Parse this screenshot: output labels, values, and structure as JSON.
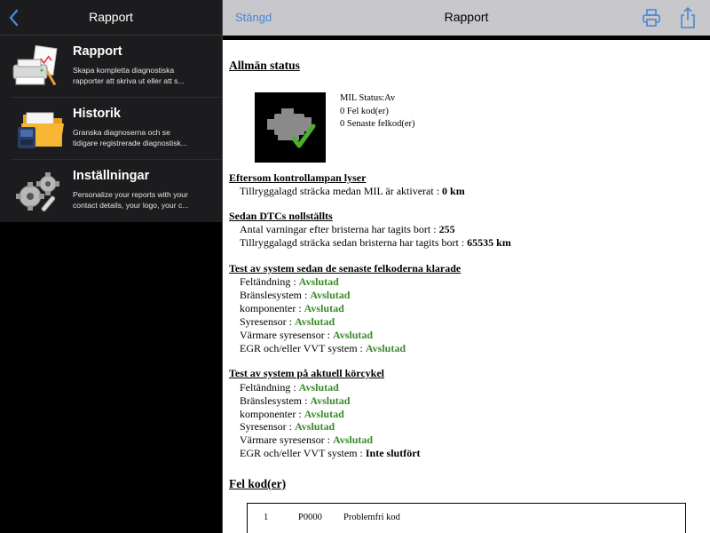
{
  "left": {
    "title": "Rapport",
    "menu": [
      {
        "title": "Rapport",
        "desc_line1": "Skapa kompletta diagnostiska",
        "desc_line2": "rapporter att skriva ut eller att s...",
        "icon": "report-printer-icon"
      },
      {
        "title": "Historik",
        "desc_line1": "Granska diagnoserna och se",
        "desc_line2": "tidigare registrerade diagnostisk...",
        "icon": "history-folder-icon"
      },
      {
        "title": "Inställningar",
        "desc_line1": "Personalize your reports with your",
        "desc_line2": "contact details, your logo, your c...",
        "icon": "settings-gears-icon"
      }
    ]
  },
  "right": {
    "close_label": "Stängd",
    "title": "Rapport"
  },
  "report": {
    "general_status": {
      "heading": "Allmän status",
      "mil_status": "MIL Status:Av",
      "fault_codes": "0 Fel kod(er)",
      "recent_fault_codes": "0 Senaste felkod(er)"
    },
    "mil_on": {
      "heading": "Eftersom kontrollampan lyser",
      "distance_label": "Tillryggalagd sträcka medan MIL är aktiverat : ",
      "distance_value": "0 km"
    },
    "dtcs_cleared": {
      "heading": "Sedan DTCs nollställts",
      "warmups_label": "Antal varningar efter bristerna har tagits bort : ",
      "warmups_value": "255",
      "distance_label": "Tillryggalagd sträcka sedan bristerna har tagits bort : ",
      "distance_value": "65535 km"
    },
    "since_clear_tests": {
      "heading": "Test av system sedan de senaste felkoderna klarade",
      "items": [
        {
          "label": "Feltändning : ",
          "value": "Avslutad"
        },
        {
          "label": "Bränslesystem : ",
          "value": "Avslutad"
        },
        {
          "label": "komponenter : ",
          "value": "Avslutad"
        },
        {
          "label": "Syresensor : ",
          "value": "Avslutad"
        },
        {
          "label": "Värmare syresensor : ",
          "value": "Avslutad"
        },
        {
          "label": "EGR och/eller VVT system : ",
          "value": "Avslutad"
        }
      ]
    },
    "current_cycle_tests": {
      "heading": "Test av system på aktuell körcykel",
      "items": [
        {
          "label": "Feltändning : ",
          "value": "Avslutad"
        },
        {
          "label": "Bränslesystem : ",
          "value": "Avslutad"
        },
        {
          "label": "komponenter : ",
          "value": "Avslutad"
        },
        {
          "label": "Syresensor : ",
          "value": "Avslutad"
        },
        {
          "label": "Värmare syresensor : ",
          "value": "Avslutad"
        },
        {
          "label": "EGR och/eller VVT system : ",
          "value": "Inte slutfört"
        }
      ]
    },
    "fault_codes": {
      "heading": "Fel kod(er)",
      "rows": [
        {
          "index": "1",
          "code": "P0000",
          "description": "Problemfri kod"
        }
      ]
    }
  },
  "colors": {
    "ok_green": "#3a8a2a",
    "link_blue": "#4a86d4",
    "header_gray": "#c8c7cc"
  }
}
